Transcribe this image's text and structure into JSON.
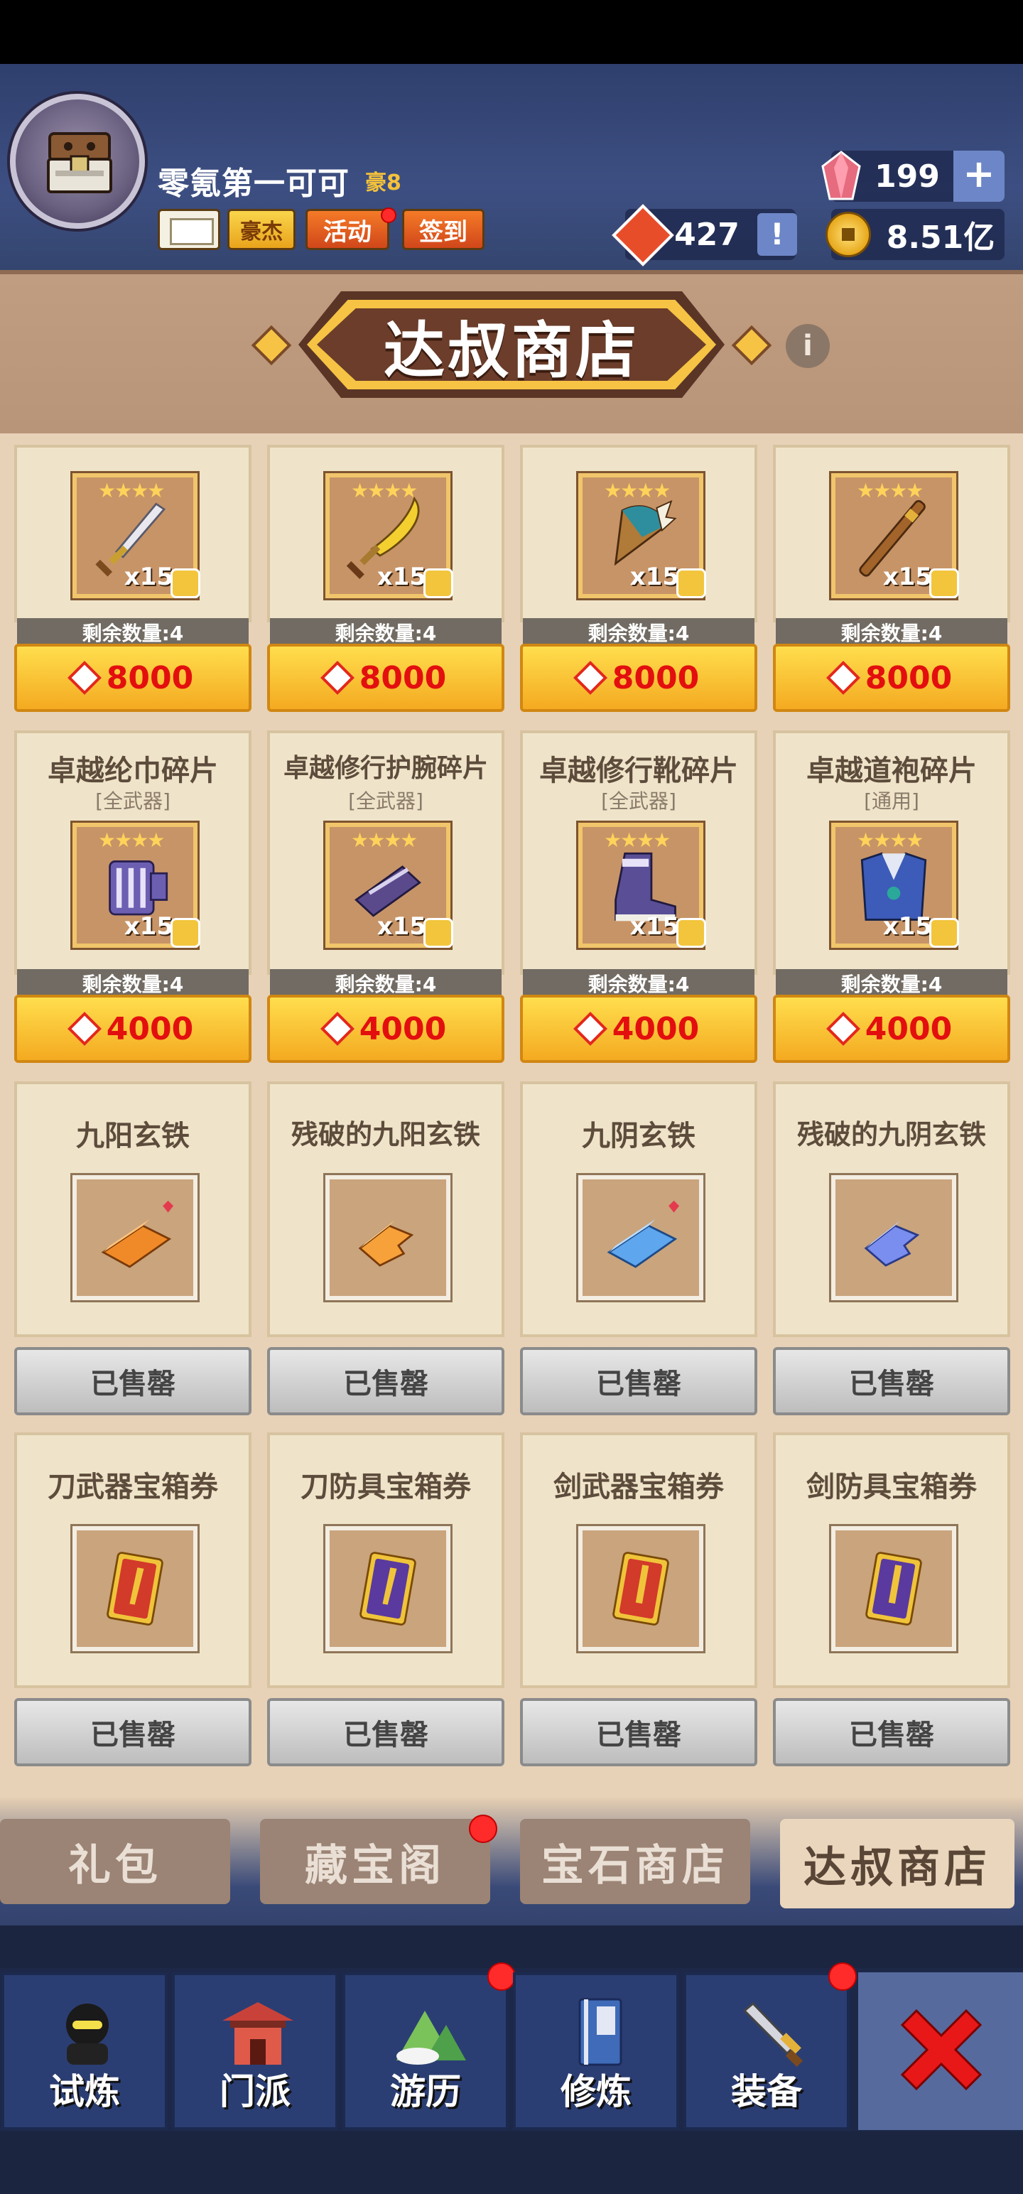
{
  "player": {
    "name": "零氪第一可可",
    "vip": "豪8",
    "buttons": {
      "haojie": "豪杰",
      "activity": "活动",
      "signin": "签到"
    },
    "gems": "199",
    "honor": "427",
    "coins": "8.51亿"
  },
  "shop": {
    "title": "达叔商店",
    "rows": [
      {
        "type": "price",
        "items": [
          {
            "name": "",
            "sub": "",
            "stars": "★★★★",
            "qty": "x15",
            "remain": "剩余数量:4",
            "price": "8000",
            "icon": "sword-icon"
          },
          {
            "name": "",
            "sub": "",
            "stars": "★★★★",
            "qty": "x15",
            "remain": "剩余数量:4",
            "price": "8000",
            "icon": "broadsword-icon"
          },
          {
            "name": "",
            "sub": "",
            "stars": "★★★★",
            "qty": "x15",
            "remain": "剩余数量:4",
            "price": "8000",
            "icon": "fan-icon"
          },
          {
            "name": "",
            "sub": "",
            "stars": "★★★★",
            "qty": "x15",
            "remain": "剩余数量:4",
            "price": "8000",
            "icon": "staff-icon"
          }
        ]
      },
      {
        "type": "price",
        "items": [
          {
            "name": "卓越纶巾碎片",
            "sub": "[全武器]",
            "stars": "★★★★",
            "qty": "x15",
            "remain": "剩余数量:4",
            "price": "4000",
            "icon": "headwear-icon"
          },
          {
            "name": "卓越修行护腕碎片",
            "sub": "[全武器]",
            "stars": "★★★★",
            "qty": "x15",
            "remain": "剩余数量:4",
            "price": "4000",
            "icon": "bracer-icon"
          },
          {
            "name": "卓越修行靴碎片",
            "sub": "[全武器]",
            "stars": "★★★★",
            "qty": "x15",
            "remain": "剩余数量:4",
            "price": "4000",
            "icon": "boots-icon"
          },
          {
            "name": "卓越道袍碎片",
            "sub": "[通用]",
            "stars": "★★★★",
            "qty": "x15",
            "remain": "剩余数量:4",
            "price": "4000",
            "icon": "robe-icon"
          }
        ]
      },
      {
        "type": "sold",
        "items": [
          {
            "name": "九阳玄铁",
            "sold": "已售罄",
            "icon": "orange-iron-icon"
          },
          {
            "name": "残破的九阳玄铁",
            "sold": "已售罄",
            "icon": "broken-orange-iron-icon"
          },
          {
            "name": "九阴玄铁",
            "sold": "已售罄",
            "icon": "blue-iron-icon"
          },
          {
            "name": "残破的九阴玄铁",
            "sold": "已售罄",
            "icon": "broken-blue-iron-icon"
          }
        ]
      },
      {
        "type": "sold",
        "items": [
          {
            "name": "刀武器宝箱券",
            "sold": "已售罄",
            "icon": "blade-weapon-ticket-icon"
          },
          {
            "name": "刀防具宝箱券",
            "sold": "已售罄",
            "icon": "blade-armor-ticket-icon"
          },
          {
            "name": "剑武器宝箱券",
            "sold": "已售罄",
            "icon": "sword-weapon-ticket-icon"
          },
          {
            "name": "剑防具宝箱券",
            "sold": "已售罄",
            "icon": "sword-armor-ticket-icon"
          }
        ]
      }
    ]
  },
  "tabs": [
    "礼包",
    "藏宝阁",
    "宝石商店",
    "达叔商店"
  ],
  "nav": [
    "试炼",
    "门派",
    "游历",
    "修炼",
    "装备"
  ],
  "colors": {
    "accent": "#f4aa21",
    "price_text": "#e30f0f",
    "reddot": "#ff2a2a",
    "header": "#34456f"
  }
}
